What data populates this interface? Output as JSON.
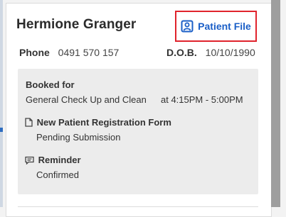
{
  "patient": {
    "name": "Hermione Granger",
    "patient_file_label": "Patient File",
    "phone_label": "Phone",
    "phone": "0491 570 157",
    "dob_label": "D.O.B.",
    "dob": "10/10/1990"
  },
  "booking": {
    "booked_for_label": "Booked for",
    "service": "General Check Up and Clean",
    "time": "at 4:15PM - 5:00PM"
  },
  "form": {
    "title": "New Patient Registration Form",
    "status": "Pending Submission",
    "icon": "document-icon"
  },
  "reminder": {
    "title": "Reminder",
    "status": "Confirmed",
    "icon": "message-icon"
  },
  "colors": {
    "accent": "#1b5fc7",
    "highlight_border": "#e0232c"
  }
}
